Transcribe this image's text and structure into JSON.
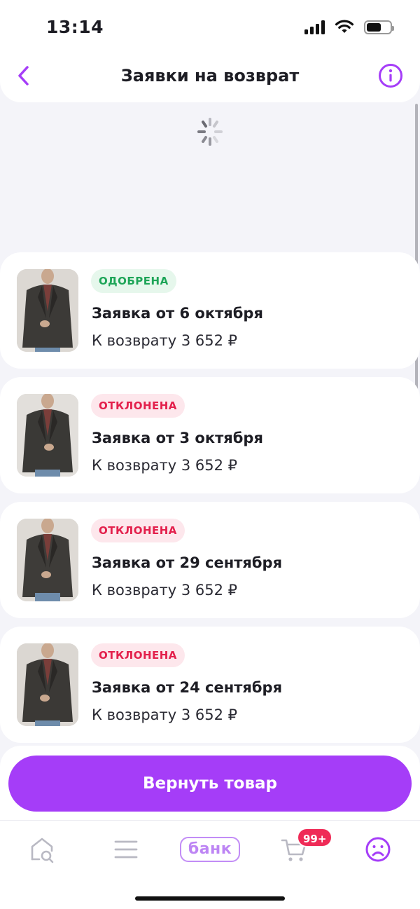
{
  "status_bar": {
    "time": "13:14"
  },
  "header": {
    "title": "Заявки на возврат"
  },
  "requests": [
    {
      "status": "ОДОБРЕНА",
      "status_kind": "approved",
      "title": "Заявка от 6 октября",
      "amount": "К возврату 3 652 ₽"
    },
    {
      "status": "ОТКЛОНЕНА",
      "status_kind": "rejected",
      "title": "Заявка от 3 октября",
      "amount": "К возврату 3 652 ₽"
    },
    {
      "status": "ОТКЛОНЕНА",
      "status_kind": "rejected",
      "title": "Заявка от 29 сентября",
      "amount": "К возврату 3 652 ₽"
    },
    {
      "status": "ОТКЛОНЕНА",
      "status_kind": "rejected",
      "title": "Заявка от 24 сентября",
      "amount": "К возврату 3 652 ₽"
    }
  ],
  "action": {
    "return_label": "Вернуть товар"
  },
  "tabbar": {
    "bank_label": "банк",
    "cart_badge": "99+",
    "items": [
      "home-search-icon",
      "catalog-menu-icon",
      "bank-tab",
      "cart-icon",
      "profile-icon"
    ]
  },
  "colors": {
    "accent": "#a53df8",
    "approved": "#1ea558",
    "rejected": "#e3204c"
  }
}
